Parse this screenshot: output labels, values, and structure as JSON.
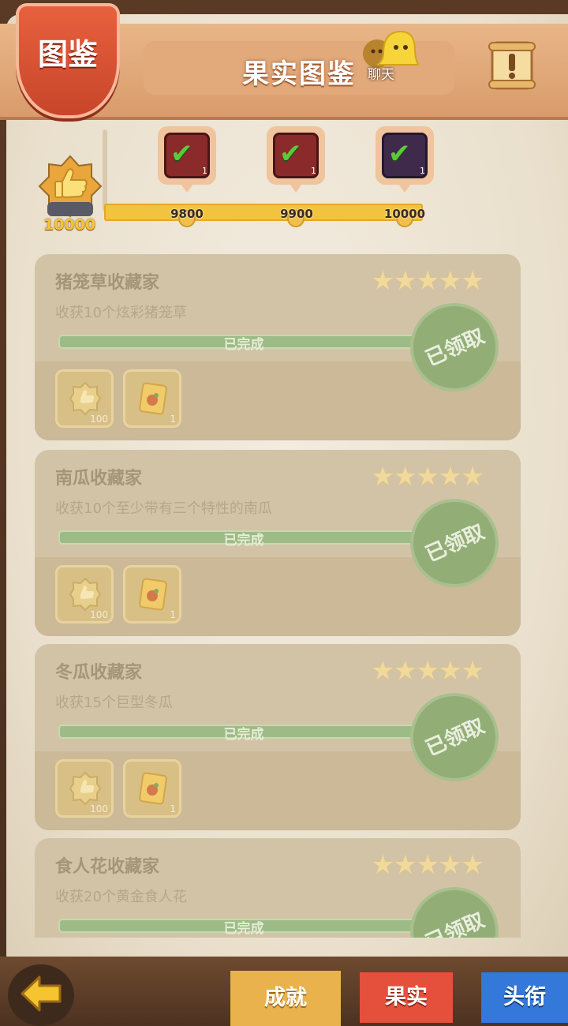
{
  "header": {
    "badge_label": "图鉴",
    "title": "果实图鉴",
    "chat_label": "聊天",
    "chat_icon": "chat-bubbles-icon",
    "menu_icon": "scroll-notice-icon"
  },
  "milestones": {
    "current_score": "10000",
    "trophy_icon": "thumbs-up-trophy-icon",
    "items": [
      {
        "value": "9800",
        "count": "1",
        "claimed": true,
        "frame": "red"
      },
      {
        "value": "9900",
        "count": "1",
        "claimed": true,
        "frame": "red"
      },
      {
        "value": "10000",
        "count": "1",
        "claimed": true,
        "frame": "purple"
      }
    ]
  },
  "cards": [
    {
      "title": "猪笼草收藏家",
      "desc": "收获10个炫彩猪笼草",
      "stars": "★★★★★",
      "progress_text": "已完成",
      "stamp": "已领取",
      "rewards": [
        {
          "icon": "thumbs-up-badge-icon",
          "count": "100"
        },
        {
          "icon": "fruit-card-icon",
          "count": "1"
        }
      ]
    },
    {
      "title": "南瓜收藏家",
      "desc": "收获10个至少带有三个特性的南瓜",
      "stars": "★★★★★",
      "progress_text": "已完成",
      "stamp": "已领取",
      "rewards": [
        {
          "icon": "thumbs-up-badge-icon",
          "count": "100"
        },
        {
          "icon": "fruit-card-icon",
          "count": "1"
        }
      ]
    },
    {
      "title": "冬瓜收藏家",
      "desc": "收获15个巨型冬瓜",
      "stars": "★★★★★",
      "progress_text": "已完成",
      "stamp": "已领取",
      "rewards": [
        {
          "icon": "thumbs-up-badge-icon",
          "count": "100"
        },
        {
          "icon": "fruit-card-icon",
          "count": "1"
        }
      ]
    },
    {
      "title": "食人花收藏家",
      "desc": "收获20个黄金食人花",
      "stars": "★★★★★",
      "progress_text": "已完成",
      "stamp": "已领取",
      "rewards": []
    }
  ],
  "tabs": {
    "achievement": "成就",
    "fruit": "果实",
    "title": "头衔",
    "back_icon": "back-arrow-icon"
  },
  "colors": {
    "accent_red": "#e4503c",
    "accent_yellow": "#eab24c",
    "accent_blue": "#3478d9",
    "completed_green": "#93ad76"
  }
}
